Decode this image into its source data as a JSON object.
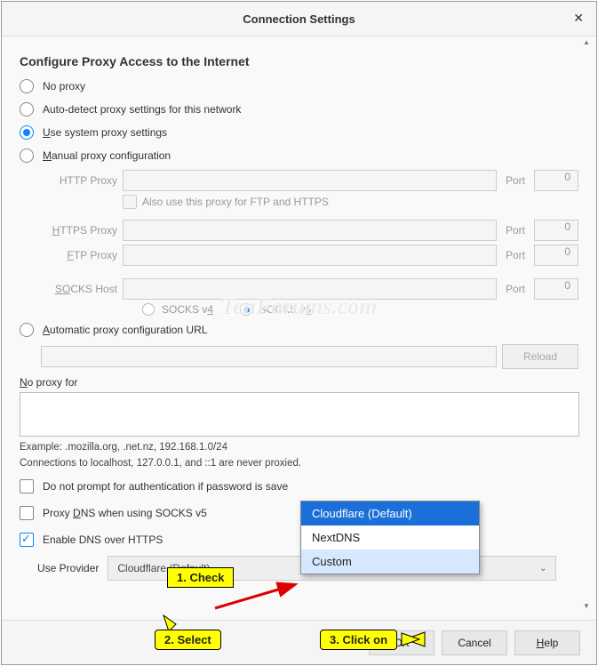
{
  "title": "Connection Settings",
  "section_heading": "Configure Proxy Access to the Internet",
  "radios": {
    "no_proxy": "No proxy",
    "auto_detect": "Auto-detect proxy settings for this network",
    "system": "se system proxy settings",
    "system_u": "U",
    "manual": "anual proxy configuration",
    "manual_u": "M",
    "auto_url": "utomatic proxy configuration URL",
    "auto_url_u": "A"
  },
  "fields": {
    "http": "HTTP Proxy",
    "https": "TTPS Proxy",
    "https_u": "H",
    "ftp": "TP Proxy",
    "ftp_u": "F",
    "socks": "CKS Host",
    "socks_u": "SO",
    "port": "Port",
    "port_val": "0",
    "also_proxy": "Also use this proxy for FTP and HTTPS",
    "socks_v4": "SOCKS v4",
    "socks_v4_u": "4",
    "socks_v5": "SOCKS v",
    "socks_v5_u": "5",
    "reload": "Reload"
  },
  "noproxy": {
    "label_u": "N",
    "label": "o proxy for",
    "example": "Example: .mozilla.org, .net.nz, 192.168.1.0/24",
    "localhost_note": "Connections to localhost, 127.0.0.1, and ::1 are never proxied."
  },
  "checks": {
    "no_prompt": "Do not prompt for authentication if password is save",
    "proxy_dns": "NS when using SOCKS v5",
    "proxy_dns_pre": "Proxy ",
    "proxy_dns_u": "D",
    "enable_doh": "Enable DNS over HTTPS"
  },
  "provider": {
    "label": "Use Provider",
    "value": "Cloudflare (Default)"
  },
  "dropdown": {
    "opt1": "Cloudflare (Default)",
    "opt2": "NextDNS",
    "opt3": "Custom"
  },
  "footer": {
    "ok": "OK",
    "cancel": "Cancel",
    "help": "elp",
    "help_u": "H"
  },
  "callouts": {
    "c1": "1. Check",
    "c2": "2. Select",
    "c3": "3. Click on"
  },
  "watermark": "TenForums.com"
}
